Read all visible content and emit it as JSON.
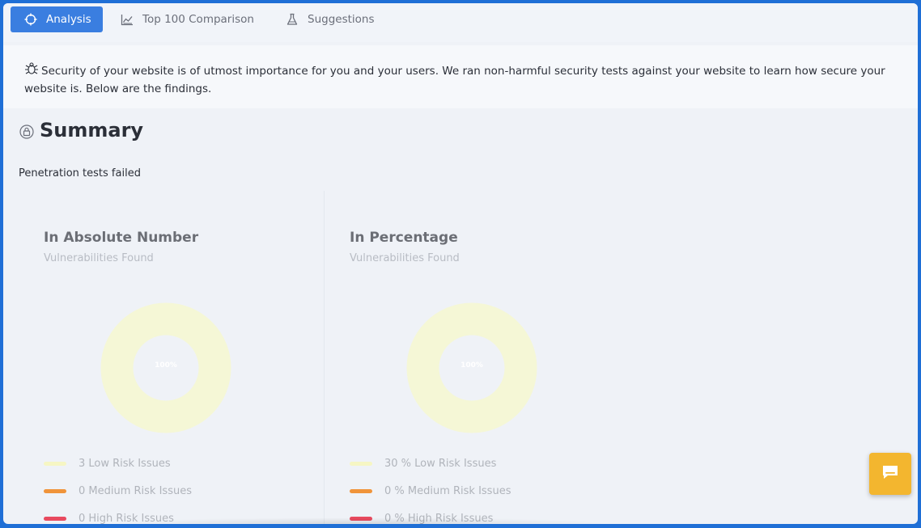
{
  "tabs": [
    {
      "label": "Analysis",
      "icon": "crosshair-icon",
      "active": true
    },
    {
      "label": "Top 100 Comparison",
      "icon": "chart-icon",
      "active": false
    },
    {
      "label": "Suggestions",
      "icon": "flask-icon",
      "active": false
    }
  ],
  "intro": {
    "icon": "bug-icon",
    "text": "Security of your website is of utmost importance for you and your users. We ran non-harmful security tests against your website to learn how secure your website is. Below are the findings."
  },
  "summary": {
    "title": "Summary",
    "icon": "lock-icon",
    "subtitle": "Penetration tests failed"
  },
  "panels": [
    {
      "title": "In Absolute Number",
      "subtitle": "Vulnerabilities Found",
      "center_label": "100%",
      "legend": [
        {
          "text": "3 Low Risk Issues",
          "color": "#f6f6c4"
        },
        {
          "text": "0 Medium Risk Issues",
          "color": "#f0943a"
        },
        {
          "text": "0 High Risk Issues",
          "color": "#e84a5f"
        }
      ]
    },
    {
      "title": "In Percentage",
      "subtitle": "Vulnerabilities Found",
      "center_label": "100%",
      "legend": [
        {
          "text": "30 % Low Risk Issues",
          "color": "#f6f6c4"
        },
        {
          "text": "0 % Medium Risk Issues",
          "color": "#f0943a"
        },
        {
          "text": "0 % High Risk Issues",
          "color": "#e84a5f"
        }
      ]
    }
  ],
  "colors": {
    "accent": "#3a7ee0",
    "donut": "#f5f7d6",
    "chat": "#f3b62f"
  },
  "chat": {
    "icon": "chat-icon"
  }
}
